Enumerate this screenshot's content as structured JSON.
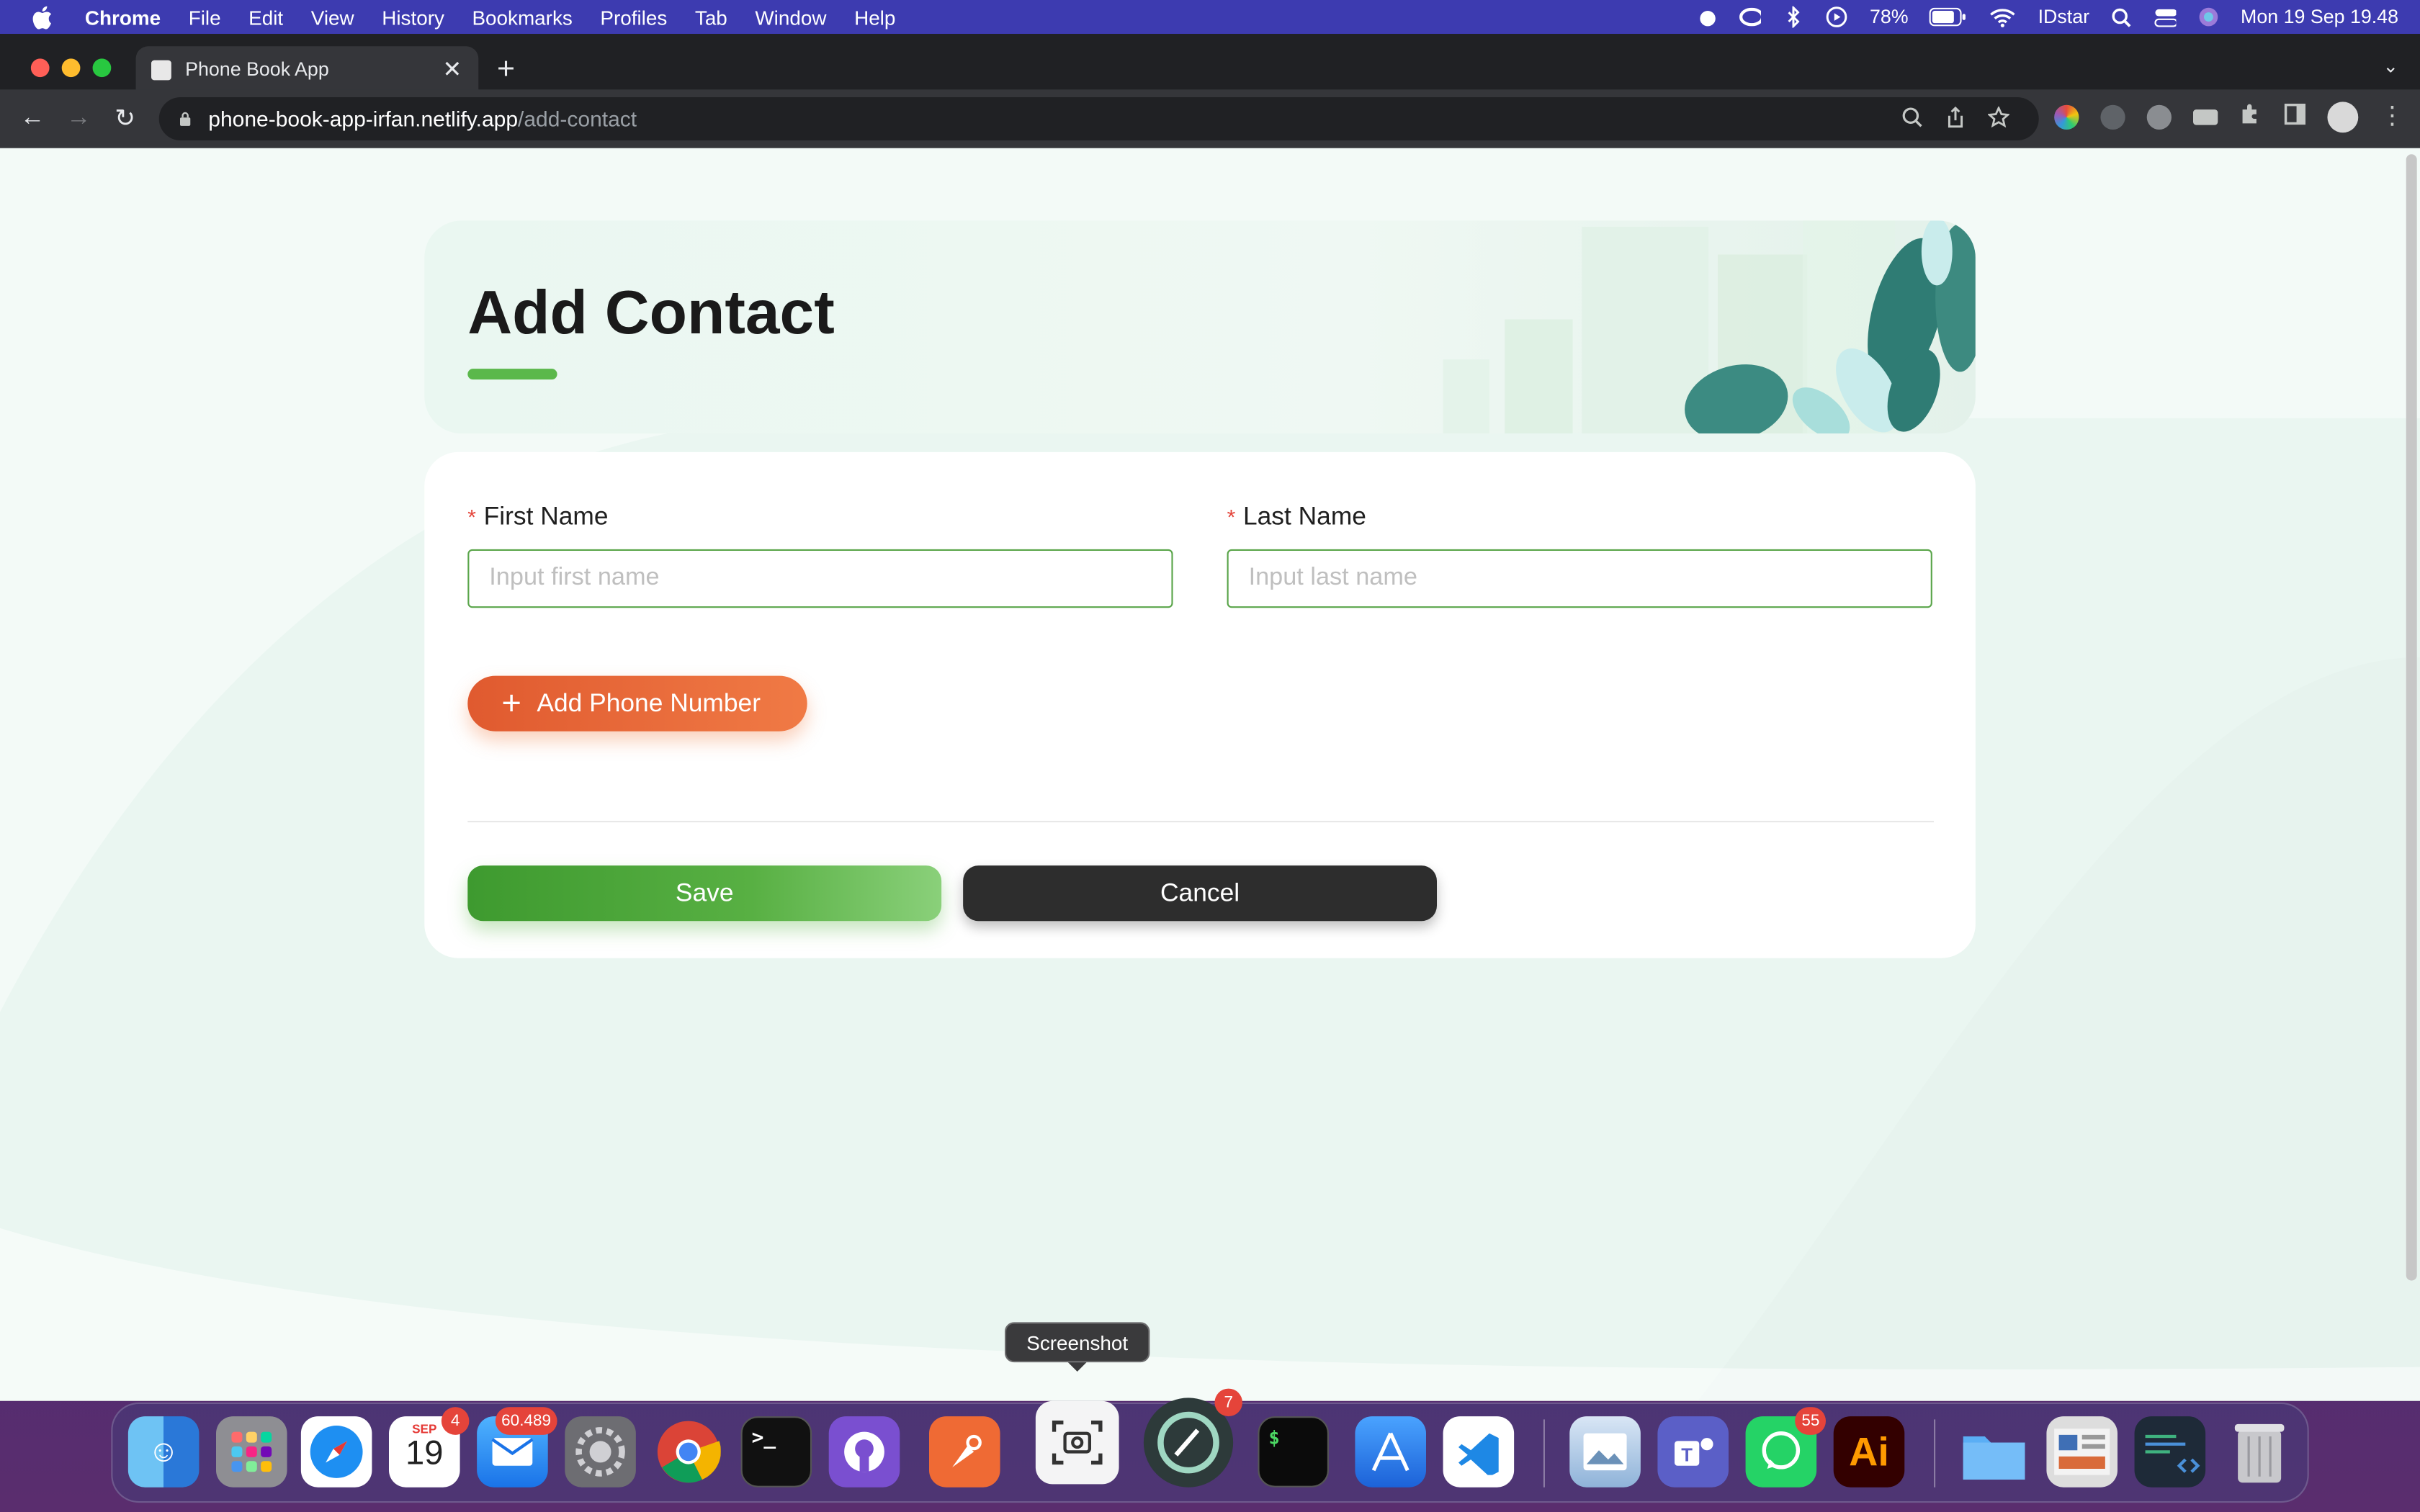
{
  "menubar": {
    "app": "Chrome",
    "items": [
      "File",
      "Edit",
      "View",
      "History",
      "Bookmarks",
      "Profiles",
      "Tab",
      "Window",
      "Help"
    ],
    "battery": "78%",
    "user": "IDstar",
    "clock": "Mon 19 Sep  19.48"
  },
  "browser": {
    "tab_title": "Phone Book App",
    "url_host": "phone-book-app-irfan.netlify.app",
    "url_path": "/add-contact"
  },
  "page": {
    "title": "Add Contact",
    "first_name": {
      "label": "First Name",
      "required_mark": "*",
      "placeholder": "Input first name",
      "value": ""
    },
    "last_name": {
      "label": "Last Name",
      "required_mark": "*",
      "placeholder": "Input last name",
      "value": ""
    },
    "add_phone_label": "Add Phone Number",
    "save_label": "Save",
    "cancel_label": "Cancel"
  },
  "dock": {
    "tooltip": "Screenshot",
    "calendar": {
      "month": "SEP",
      "day": "19",
      "badge": "4"
    },
    "mail_badge": "60.489",
    "clock_badge": "7",
    "whatsapp_badge": "55",
    "illustrator_label": "Ai"
  },
  "colors": {
    "accent_green": "#5bb84b",
    "input_border": "#5aa54a",
    "add_phone_orange": "#e05a2f",
    "cancel_dark": "#2d2d2d",
    "page_bg": "#f3faf7"
  }
}
